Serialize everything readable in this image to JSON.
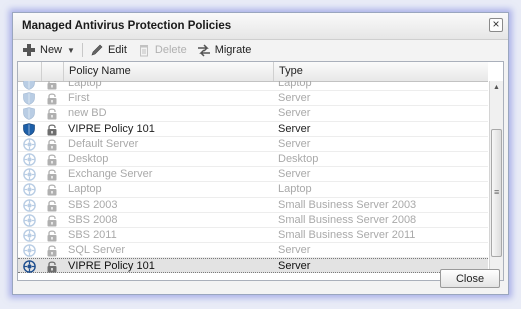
{
  "dialog": {
    "title": "Managed Antivirus Protection Policies",
    "close_glyph": "×"
  },
  "toolbar": {
    "new_label": "New",
    "edit_label": "Edit",
    "delete_label": "Delete",
    "migrate_label": "Migrate"
  },
  "grid": {
    "columns": [
      "Policy Name",
      "Type"
    ],
    "rows": [
      {
        "icon": "shield-icon",
        "name": "Laptop",
        "type": "Laptop",
        "state": "dim"
      },
      {
        "icon": "shield-icon",
        "name": "First",
        "type": "Server",
        "state": "dim"
      },
      {
        "icon": "shield-icon",
        "name": "new BD",
        "type": "Server",
        "state": "dim"
      },
      {
        "icon": "shield-icon",
        "name": "VIPRE Policy 101",
        "type": "Server",
        "state": "active"
      },
      {
        "icon": "gear-icon",
        "name": "Default Server",
        "type": "Server",
        "state": "dim"
      },
      {
        "icon": "gear-icon",
        "name": "Desktop",
        "type": "Desktop",
        "state": "dim"
      },
      {
        "icon": "gear-icon",
        "name": "Exchange Server",
        "type": "Server",
        "state": "dim"
      },
      {
        "icon": "gear-icon",
        "name": "Laptop",
        "type": "Laptop",
        "state": "dim"
      },
      {
        "icon": "gear-icon",
        "name": "SBS 2003",
        "type": "Small Business Server 2003",
        "state": "dim"
      },
      {
        "icon": "gear-icon",
        "name": "SBS 2008",
        "type": "Small Business Server 2008",
        "state": "dim"
      },
      {
        "icon": "gear-icon",
        "name": "SBS 2011",
        "type": "Small Business Server 2011",
        "state": "dim"
      },
      {
        "icon": "gear-icon",
        "name": "SQL Server",
        "type": "Server",
        "state": "dim"
      },
      {
        "icon": "gear-icon",
        "name": "VIPRE Policy 101",
        "type": "Server",
        "state": "selected"
      }
    ]
  },
  "footer": {
    "close_label": "Close"
  },
  "colors": {
    "shield_active": "#1d5fa8",
    "icon_dim": "#b9cde4",
    "gear_active": "#1f4f8f",
    "lock": "#b0b0b0"
  }
}
